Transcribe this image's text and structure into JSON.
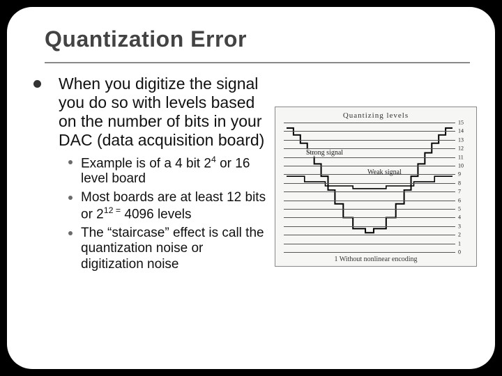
{
  "title": "Quantization Error",
  "bullets": {
    "main": "When you digitize the signal you do so with levels based on the number of bits in your DAC (data acquisition board)",
    "sub1_pre": "Example is of a 4 bit 2",
    "sub1_sup": "4",
    "sub1_post": " or 16 level board",
    "sub2_pre": "Most boards are at least 12 bits or 2",
    "sub2_sup": "12 =",
    "sub2_post": " 4096 levels",
    "sub3": "The “staircase” effect is call the quantization noise or digitization noise"
  },
  "figure": {
    "title": "Quantizing levels",
    "caption": "1 Without nonlinear encoding",
    "strong_label": "Strong signal",
    "weak_label": "Weak signal",
    "levels": [
      "15",
      "14",
      "13",
      "12",
      "11",
      "10",
      "9",
      "8",
      "7",
      "6",
      "5",
      "4",
      "3",
      "2",
      "1",
      "0"
    ]
  }
}
